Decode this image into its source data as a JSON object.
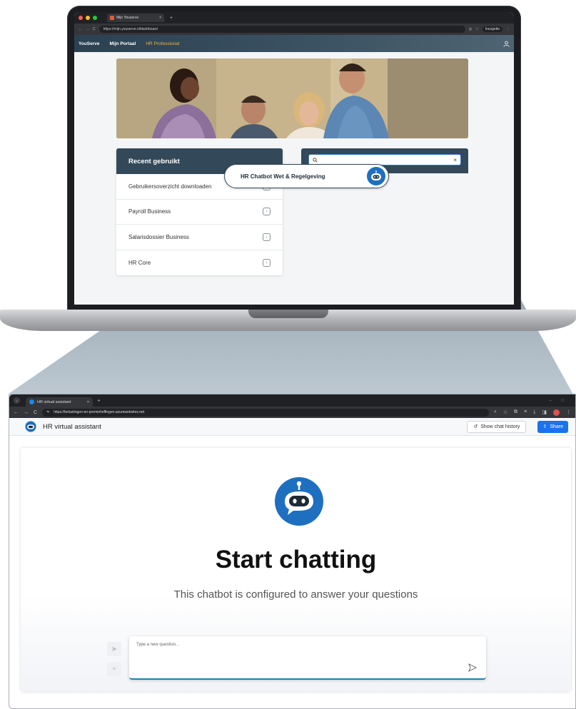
{
  "laptop": {
    "tab_title": "Mijn Youserve",
    "url": "https://mijn.youserve.nl/dashboard",
    "incognito_label": "Incognito",
    "header": {
      "logo": "YouServe",
      "nav": [
        "Mijn Portaal",
        "HR Professional"
      ]
    },
    "recent": {
      "title": "Recent gebruikt",
      "items": [
        "Gebruikersoverzicht downloaden",
        "Payroll Business",
        "Salarisdossier Business",
        "HR Core"
      ]
    },
    "search": {
      "value": "",
      "result": "HR Chatbot Wet & Regelgeving"
    }
  },
  "browser": {
    "tab_title": "HR virtual assistant",
    "url": "https://belastingen-en-premieheffingen.azurewebsites.net"
  },
  "app": {
    "title": "HR virtual assistant",
    "history_button": "Show chat history",
    "share_button": "Share",
    "heading": "Start chatting",
    "subheading": "This chatbot is configured to answer your questions",
    "input_placeholder": "Type a new question..."
  },
  "colors": {
    "navy": "#33495a",
    "accent_orange": "#f2b43a",
    "bot_blue": "#1e6fc0",
    "share_blue": "#1a73e8"
  }
}
